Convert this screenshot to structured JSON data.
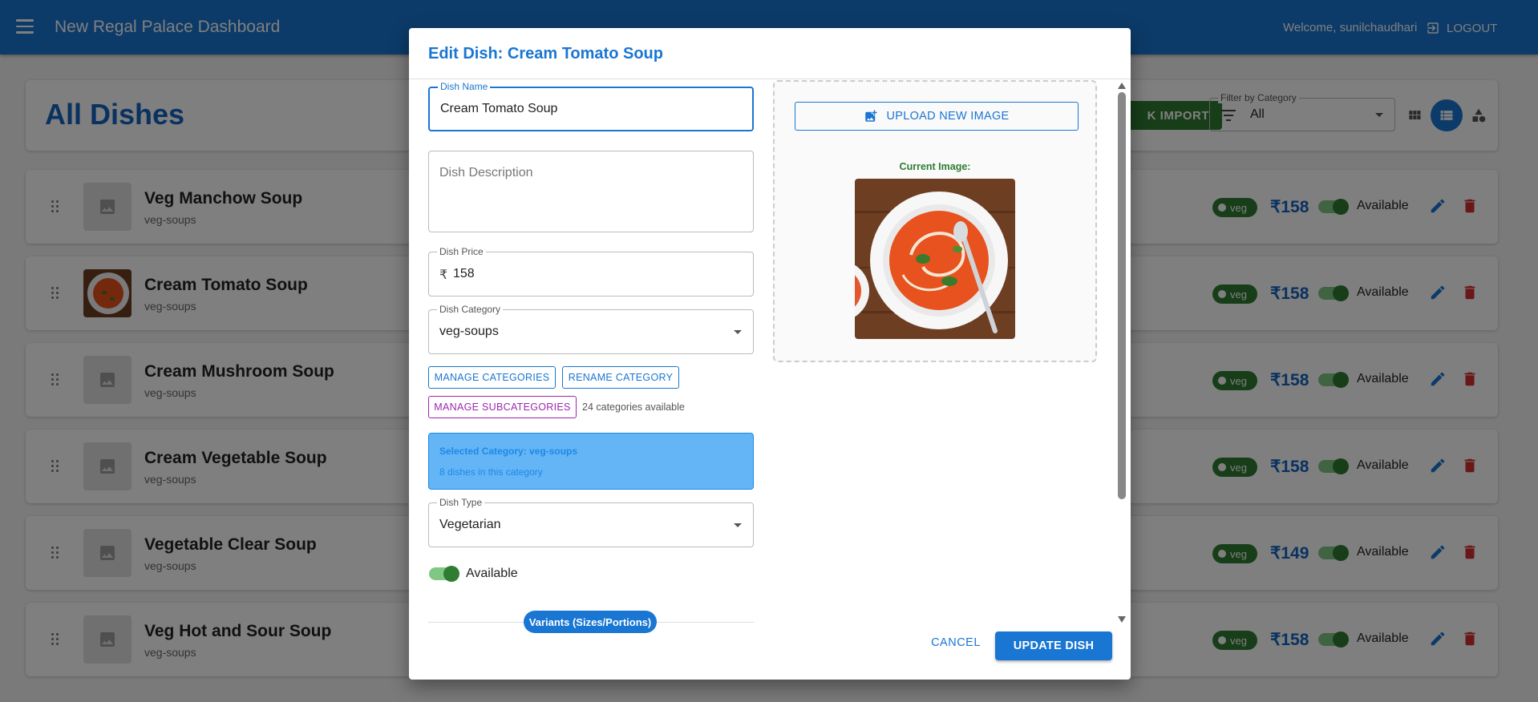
{
  "appbar": {
    "title": "New Regal Palace Dashboard",
    "welcome": "Welcome, sunilchaudhari",
    "logout_label": "LOGOUT"
  },
  "header": {
    "title": "All Dishes",
    "bulk_import_label": "K IMPORT",
    "filter_label": "Filter by Category",
    "filter_value": "All"
  },
  "rows": [
    {
      "name": "Veg Manchow Soup",
      "category": "veg-soups",
      "badge": "veg",
      "price": "₹158",
      "status": "Available",
      "has_image": false
    },
    {
      "name": "Cream Tomato Soup",
      "category": "veg-soups",
      "badge": "veg",
      "price": "₹158",
      "status": "Available",
      "has_image": true
    },
    {
      "name": "Cream Mushroom Soup",
      "category": "veg-soups",
      "badge": "veg",
      "price": "₹158",
      "status": "Available",
      "has_image": false
    },
    {
      "name": "Cream Vegetable Soup",
      "category": "veg-soups",
      "badge": "veg",
      "price": "₹158",
      "status": "Available",
      "has_image": false
    },
    {
      "name": "Vegetable Clear Soup",
      "category": "veg-soups",
      "badge": "veg",
      "price": "₹149",
      "status": "Available",
      "has_image": false
    },
    {
      "name": "Veg Hot and Sour Soup",
      "category": "veg-soups",
      "badge": "veg",
      "price": "₹158",
      "status": "Available",
      "has_image": false
    }
  ],
  "dialog": {
    "title": "Edit Dish: Cream Tomato Soup",
    "dish_name_label": "Dish Name",
    "dish_name_value": "Cream Tomato Soup",
    "description_placeholder": "Dish Description",
    "price_label": "Dish Price",
    "currency_symbol": "₹",
    "price_value": "158",
    "category_label": "Dish Category",
    "category_value": "veg-soups",
    "manage_categories_label": "MANAGE CATEGORIES",
    "rename_category_label": "RENAME CATEGORY",
    "manage_subcategories_label": "MANAGE SUBCATEGORIES",
    "categories_count": "24 categories available",
    "selected_category_text": "Selected Category: veg-soups",
    "selected_category_count": "8 dishes in this category",
    "dish_type_label": "Dish Type",
    "dish_type_value": "Vegetarian",
    "available_label": "Available",
    "available": true,
    "variants_label": "Variants (Sizes/Portions)",
    "upload_label": "UPLOAD NEW IMAGE",
    "current_image_label": "Current Image:",
    "cancel_label": "CANCEL",
    "update_label": "UPDATE DISH"
  },
  "colors": {
    "primary": "#1976d2",
    "success": "#2e7d32",
    "danger": "#d32f2f",
    "purple": "#9c27b0"
  }
}
